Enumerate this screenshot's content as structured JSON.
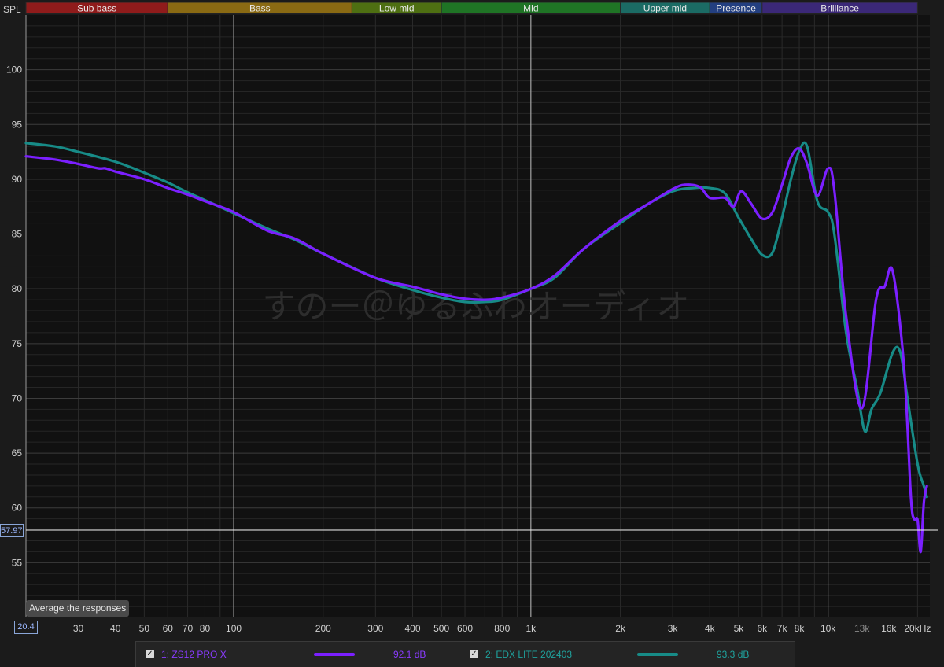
{
  "yaxis": {
    "title": "SPL",
    "ticks": [
      100,
      95,
      90,
      85,
      80,
      75,
      70,
      65,
      60,
      55
    ],
    "tick_labels": [
      "100",
      "95",
      "90",
      "85",
      "80",
      "75",
      "70",
      "65",
      "60",
      "55"
    ],
    "cursor_readout": "57.97"
  },
  "xaxis": {
    "cursor_readout": "20.4",
    "ticks": [
      {
        "f": 30,
        "label": "30"
      },
      {
        "f": 40,
        "label": "40"
      },
      {
        "f": 50,
        "label": "50"
      },
      {
        "f": 60,
        "label": "60"
      },
      {
        "f": 70,
        "label": "70"
      },
      {
        "f": 80,
        "label": "80"
      },
      {
        "f": 100,
        "label": "100"
      },
      {
        "f": 200,
        "label": "200"
      },
      {
        "f": 300,
        "label": "300"
      },
      {
        "f": 400,
        "label": "400"
      },
      {
        "f": 500,
        "label": "500"
      },
      {
        "f": 600,
        "label": "600"
      },
      {
        "f": 800,
        "label": "800"
      },
      {
        "f": 1000,
        "label": "1k"
      },
      {
        "f": 2000,
        "label": "2k"
      },
      {
        "f": 3000,
        "label": "3k"
      },
      {
        "f": 4000,
        "label": "4k"
      },
      {
        "f": 5000,
        "label": "5k"
      },
      {
        "f": 6000,
        "label": "6k"
      },
      {
        "f": 7000,
        "label": "7k"
      },
      {
        "f": 8000,
        "label": "8k"
      },
      {
        "f": 10000,
        "label": "10k"
      },
      {
        "f": 13000,
        "label": "13k"
      },
      {
        "f": 16000,
        "label": "16k"
      },
      {
        "f": 20000,
        "label": "20kHz"
      }
    ]
  },
  "bands": [
    {
      "label": "Sub bass",
      "from": 20,
      "to": 60,
      "color": "#8f1b1b"
    },
    {
      "label": "Bass",
      "from": 60,
      "to": 250,
      "color": "#8a6a13"
    },
    {
      "label": "Low mid",
      "from": 250,
      "to": 500,
      "color": "#4e6f12"
    },
    {
      "label": "Mid",
      "from": 500,
      "to": 2000,
      "color": "#1f7425"
    },
    {
      "label": "Upper mid",
      "from": 2000,
      "to": 4000,
      "color": "#1b6b64"
    },
    {
      "label": "Presence",
      "from": 4000,
      "to": 6000,
      "color": "#233f80"
    },
    {
      "label": "Brilliance",
      "from": 6000,
      "to": 20000,
      "color": "#3b2878"
    }
  ],
  "watermark": "すのー＠ゆるふわオーディオ",
  "average_button": "Average the responses",
  "chart_data": {
    "type": "line",
    "xscale": "log",
    "xlim": [
      20,
      22000
    ],
    "ylim": [
      50,
      105
    ],
    "cursor_level": 57.97,
    "series": [
      {
        "name": "1: ZS12 PRO X",
        "color": "#7b1fff",
        "level": "92.1 dB",
        "checked": true,
        "x": [
          20,
          25,
          30,
          35,
          37,
          40,
          50,
          60,
          70,
          80,
          100,
          130,
          160,
          200,
          300,
          400,
          500,
          600,
          700,
          800,
          1000,
          1200,
          1500,
          2000,
          2500,
          3000,
          3300,
          3700,
          4000,
          4500,
          4800,
          5100,
          5500,
          6000,
          6500,
          7000,
          7500,
          8000,
          8500,
          9200,
          10000,
          10500,
          11500,
          13000,
          14500,
          15500,
          16500,
          18000,
          19000,
          19500,
          20000,
          20500,
          21000,
          21500
        ],
        "y": [
          92.1,
          91.8,
          91.4,
          91.0,
          91.0,
          90.7,
          90.0,
          89.2,
          88.6,
          88.0,
          87.0,
          85.3,
          84.6,
          83.2,
          81.0,
          80.2,
          79.5,
          79.1,
          79.0,
          79.2,
          80.0,
          81.2,
          83.6,
          86.2,
          87.8,
          89.1,
          89.5,
          89.3,
          88.3,
          88.3,
          87.5,
          88.9,
          87.8,
          86.4,
          87.0,
          89.5,
          92.0,
          92.8,
          91.4,
          88.5,
          91.0,
          89.0,
          77.5,
          69.1,
          79.0,
          80.2,
          81.6,
          73.0,
          61.0,
          59.0,
          58.9,
          56.0,
          60.5,
          62.0
        ]
      },
      {
        "name": "2: EDX LITE 202403",
        "color": "#178b87",
        "level": "93.3 dB",
        "checked": true,
        "x": [
          20,
          25,
          30,
          40,
          50,
          60,
          70,
          80,
          100,
          130,
          160,
          200,
          300,
          400,
          500,
          600,
          700,
          800,
          1000,
          1200,
          1500,
          2000,
          2500,
          3000,
          3500,
          4000,
          4500,
          5000,
          5500,
          6000,
          6500,
          7000,
          7500,
          8000,
          8500,
          9200,
          10000,
          10500,
          11500,
          12500,
          13300,
          14000,
          15000,
          16500,
          17500,
          18500,
          20000,
          21000,
          21500
        ],
        "y": [
          93.3,
          93.0,
          92.5,
          91.6,
          90.6,
          89.7,
          88.8,
          88.1,
          86.9,
          85.5,
          84.5,
          83.2,
          81.0,
          79.9,
          79.2,
          78.8,
          78.8,
          79.0,
          80.0,
          81.0,
          83.6,
          86.0,
          87.8,
          88.9,
          89.2,
          89.2,
          88.7,
          86.5,
          84.6,
          83.1,
          83.3,
          86.5,
          90.0,
          92.6,
          93.0,
          88.0,
          87.0,
          85.0,
          76.0,
          71.0,
          67.0,
          69.0,
          70.5,
          74.2,
          74.2,
          70.0,
          64.0,
          62.0,
          61.0
        ]
      }
    ]
  }
}
